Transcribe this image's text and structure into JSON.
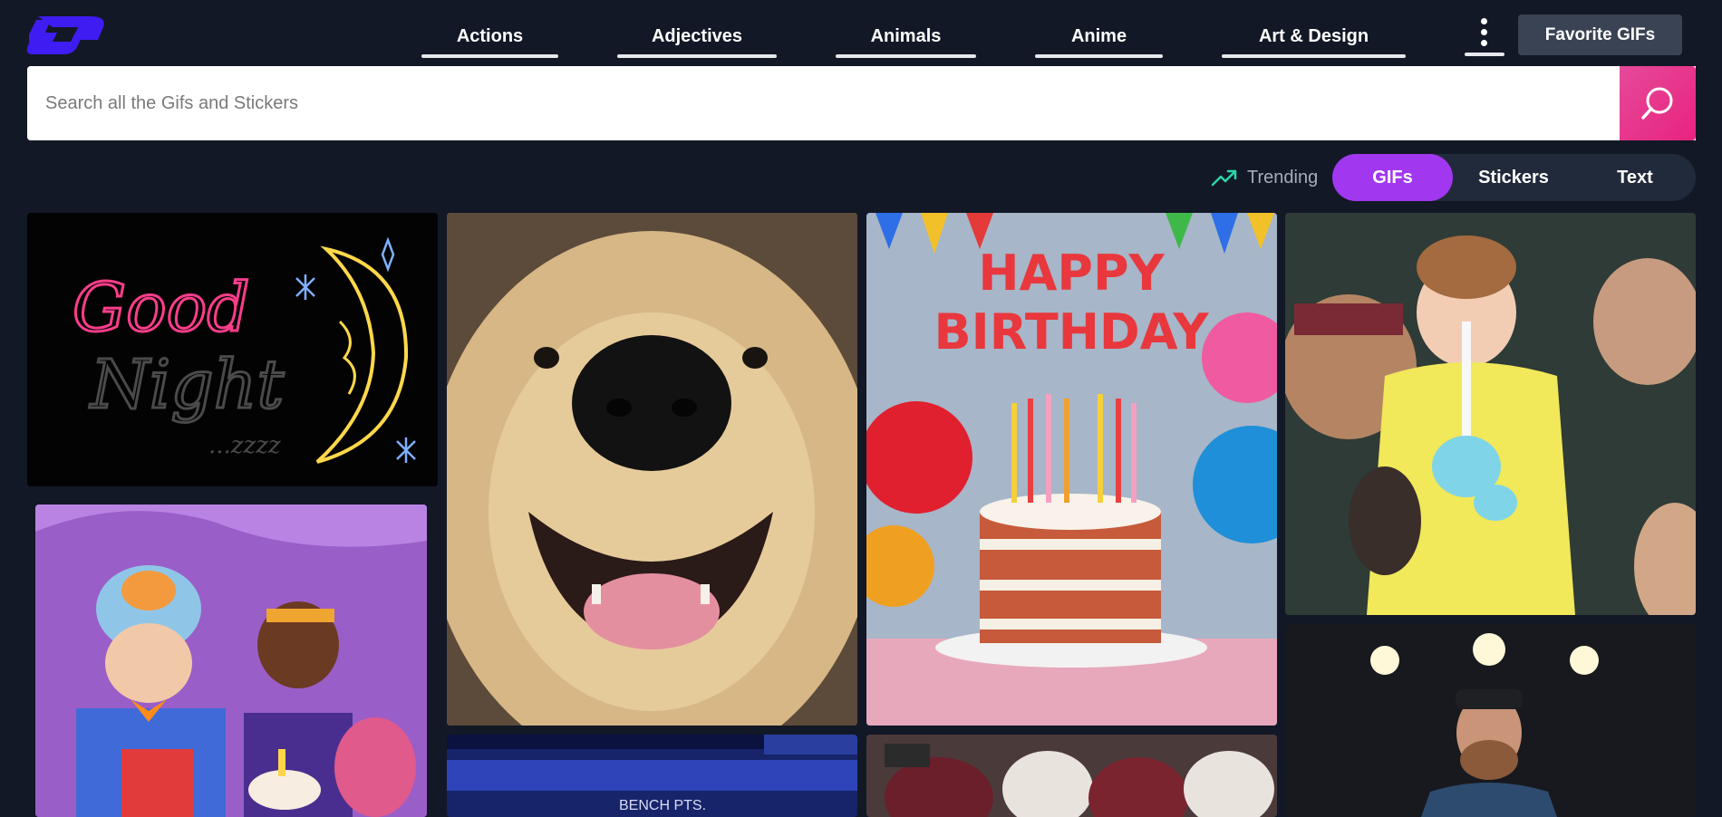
{
  "header": {
    "nav": [
      {
        "label": "Actions"
      },
      {
        "label": "Adjectives"
      },
      {
        "label": "Animals"
      },
      {
        "label": "Anime"
      },
      {
        "label": "Art & Design"
      }
    ],
    "more_icon": "kebab-menu-icon",
    "favorite_label": "Favorite GIFs"
  },
  "search": {
    "placeholder": "Search all the Gifs and Stickers",
    "value": "",
    "icon": "search-icon"
  },
  "filters": {
    "trending_label": "Trending",
    "trending_icon": "trending-up-icon",
    "tabs": [
      {
        "label": "GIFs",
        "active": true
      },
      {
        "label": "Stickers",
        "active": false
      },
      {
        "label": "Text",
        "active": false
      }
    ]
  },
  "gifs": {
    "good_night": {
      "text1": "Good",
      "text2": "Night",
      "text3": "...zzzz"
    },
    "birthday": {
      "line1": "HAPPY",
      "line2": "BIRTHDAY"
    },
    "bench_text": "BENCH PTS."
  },
  "colors": {
    "background": "#121826",
    "accent_purple": "#a237f0",
    "search_pink": "#e8237f",
    "trending_green": "#2bd6a6",
    "logo_blue": "#3e1cf2"
  }
}
